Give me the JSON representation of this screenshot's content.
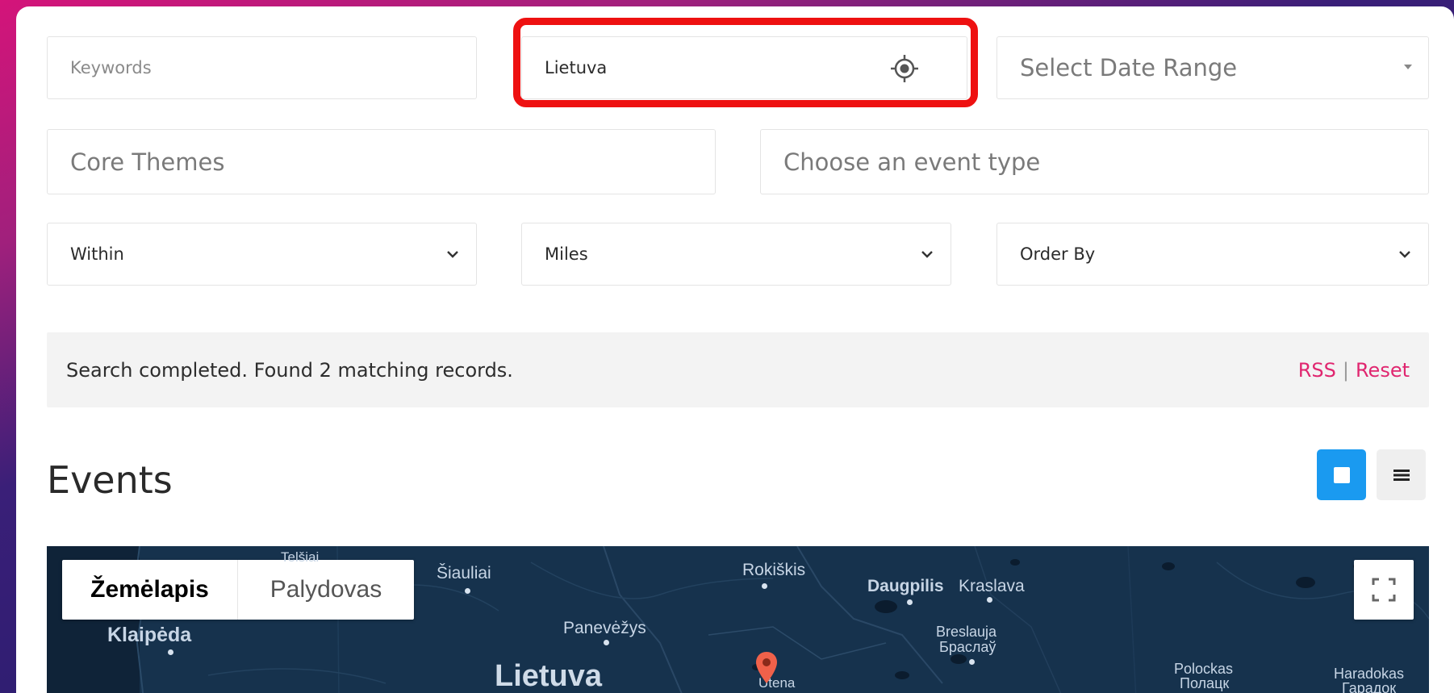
{
  "filters": {
    "keywords_placeholder": "Keywords",
    "location_value": "Lietuva",
    "date_range_placeholder": "Select Date Range",
    "core_themes_placeholder": "Core Themes",
    "event_type_placeholder": "Choose an event type",
    "within_label": "Within",
    "miles_label": "Miles",
    "order_by_label": "Order By"
  },
  "status": {
    "message": "Search completed. Found 2 matching records.",
    "rss_label": "RSS",
    "separator": "|",
    "reset_label": "Reset"
  },
  "section": {
    "title": "Events"
  },
  "map": {
    "tab_map": "Žemėlapis",
    "tab_satellite": "Palydovas",
    "labels": {
      "telsiai": "Telšiai",
      "siauliai": "Šiauliai",
      "klaipeda": "Klaipėda",
      "panevezys": "Panevėžys",
      "lietuva": "Lietuva",
      "rokiskis": "Rokiškis",
      "daugpilis": "Daugpilis",
      "kraslava": "Kraslava",
      "breslauja": "Breslauja",
      "braslau": "Браслаў",
      "utena": "Utena",
      "polockas": "Polockas",
      "polack": "Полацк",
      "haradokas": "Haradokas",
      "haradok": "Гарадок"
    }
  },
  "colors": {
    "accent_blue": "#1a9af0",
    "link_pink": "#e0266f",
    "highlight_red": "#ee1111",
    "map_bg": "#16324d",
    "marker": "#f0614a"
  }
}
